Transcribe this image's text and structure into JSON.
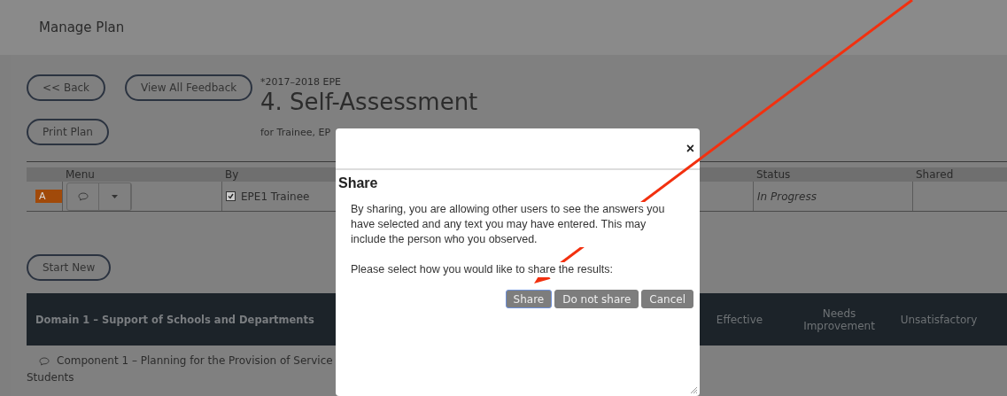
{
  "header": {
    "title": "Manage Plan"
  },
  "actions": [
    {
      "label": "<< Back"
    },
    {
      "label": "View All Feedback"
    },
    {
      "label": "Print Plan"
    }
  ],
  "plan": {
    "year": "*2017–2018 EPE",
    "title": "4. Self-Assessment",
    "subtitle": "for Trainee, EP"
  },
  "table": {
    "columns": [
      {
        "label": "Menu"
      },
      {
        "label": "By"
      },
      {
        "label": "Status"
      },
      {
        "label": "Shared"
      }
    ],
    "rows": [
      {
        "badge": "A",
        "checked": true,
        "by": "EPE1 Trainee",
        "status": "In Progress"
      }
    ]
  },
  "start_button": {
    "label": "Start New"
  },
  "domain": {
    "title": "Domain 1 – Support of Schools and Departments",
    "columns": [
      "Effective",
      "Needs Improvement",
      "Unsatisfactory"
    ]
  },
  "component": {
    "lines": [
      "Component 1 – Planning for the Provision of Service",
      "Students"
    ]
  },
  "dialog": {
    "close": "×",
    "title": "Share",
    "paragraphs": [
      "By sharing, you are allowing other users to see the answers you have selected and any text you may have entered. This may include the person who you observed.",
      "Please select how you would like to share the results:"
    ],
    "buttons": [
      {
        "label": "Share",
        "focused": true
      },
      {
        "label": "Do not share",
        "focused": false
      },
      {
        "label": "Cancel",
        "focused": false
      }
    ]
  }
}
